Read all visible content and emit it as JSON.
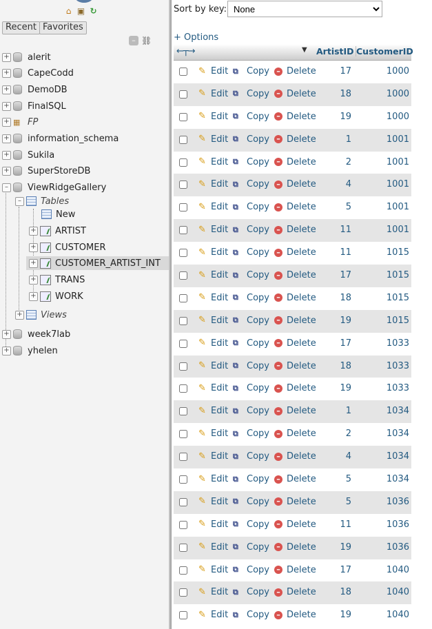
{
  "nav": {
    "recent_label": "Recent",
    "favorites_label": "Favorites",
    "databases": [
      {
        "name": "alerit"
      },
      {
        "name": "CapeCodd"
      },
      {
        "name": "DemoDB"
      },
      {
        "name": "FinalSQL"
      },
      {
        "name": "FP"
      },
      {
        "name": "information_schema"
      },
      {
        "name": "Sukila"
      },
      {
        "name": "SuperStoreDB"
      },
      {
        "name": "ViewRidgeGallery"
      },
      {
        "name": "week7lab"
      },
      {
        "name": "yhelen"
      }
    ],
    "tables_label": "Tables",
    "new_label": "New",
    "tables": [
      "ARTIST",
      "CUSTOMER",
      "CUSTOMER_ARTIST_INT",
      "TRANS",
      "WORK"
    ],
    "views_label": "Views",
    "selected_table": "CUSTOMER_ARTIST_INT"
  },
  "main": {
    "sort_label": "Sort by key:",
    "sort_value": "None",
    "options_label": "+ Options",
    "col_artist": "ArtistID",
    "col_customer": "CustomerID",
    "edit_label": "Edit",
    "copy_label": "Copy",
    "delete_label": "Delete",
    "rows": [
      {
        "artist": "17",
        "customer": "1000"
      },
      {
        "artist": "18",
        "customer": "1000"
      },
      {
        "artist": "19",
        "customer": "1000"
      },
      {
        "artist": "1",
        "customer": "1001"
      },
      {
        "artist": "2",
        "customer": "1001"
      },
      {
        "artist": "4",
        "customer": "1001"
      },
      {
        "artist": "5",
        "customer": "1001"
      },
      {
        "artist": "11",
        "customer": "1001"
      },
      {
        "artist": "11",
        "customer": "1015"
      },
      {
        "artist": "17",
        "customer": "1015"
      },
      {
        "artist": "18",
        "customer": "1015"
      },
      {
        "artist": "19",
        "customer": "1015"
      },
      {
        "artist": "17",
        "customer": "1033"
      },
      {
        "artist": "18",
        "customer": "1033"
      },
      {
        "artist": "19",
        "customer": "1033"
      },
      {
        "artist": "1",
        "customer": "1034"
      },
      {
        "artist": "2",
        "customer": "1034"
      },
      {
        "artist": "4",
        "customer": "1034"
      },
      {
        "artist": "5",
        "customer": "1034"
      },
      {
        "artist": "5",
        "customer": "1036"
      },
      {
        "artist": "11",
        "customer": "1036"
      },
      {
        "artist": "19",
        "customer": "1036"
      },
      {
        "artist": "17",
        "customer": "1040"
      },
      {
        "artist": "18",
        "customer": "1040"
      },
      {
        "artist": "19",
        "customer": "1040"
      }
    ]
  },
  "colors": {
    "link": "#235a81",
    "row_alt": "#e5e5e5",
    "nav_bg": "#f3f3f3"
  }
}
